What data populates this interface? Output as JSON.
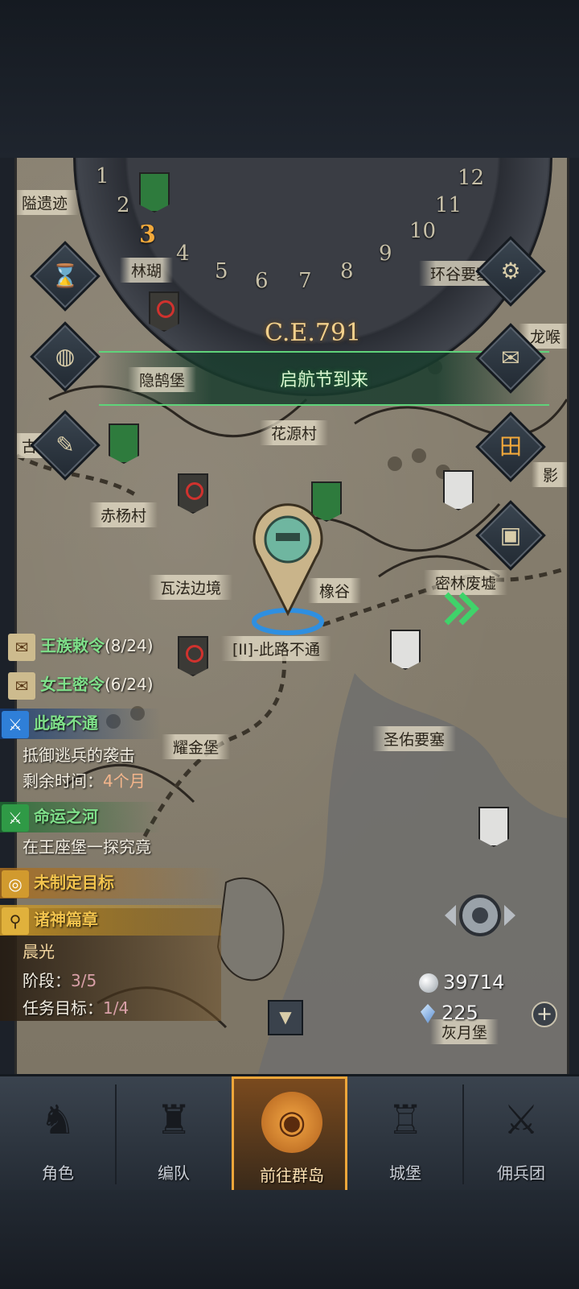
{
  "calendar": {
    "year": "C.E.791",
    "months": [
      "1",
      "2",
      "3",
      "4",
      "5",
      "6",
      "7",
      "8",
      "9",
      "10",
      "11",
      "12"
    ],
    "current_month": "3"
  },
  "event_banner": "启航节到来",
  "locations": {
    "yuyiyizhi": "隘遗迹",
    "linmu": "林瑚",
    "huangu": "环谷要塞",
    "longhou": "龙喉",
    "yinhuebao": "隐鹄堡",
    "huayuan": "花源村",
    "chiyang": "赤杨村",
    "wafa": "瓦法边境",
    "xianggu": "橡谷",
    "milin": "密林废墟",
    "cilubutong": "[II]-此路不通",
    "yaojin": "耀金堡",
    "shengyou": "圣佑要塞",
    "huoyue": "灰月堡",
    "gumu": "古木",
    "ying": "影"
  },
  "quests": {
    "royal_decree": {
      "label": "王族敕令",
      "progress": "(8/24)"
    },
    "queen_secret": {
      "label": "女王密令",
      "progress": "(6/24)"
    },
    "road_blocked": {
      "title": "此路不通",
      "desc": "抵御逃兵的袭击",
      "time_label": "剩余时间：",
      "time_value": "4个月"
    },
    "fate_river": {
      "title": "命运之河",
      "desc": "在王座堡一探究竟"
    },
    "no_goal": {
      "title": "未制定目标"
    },
    "gods_chapter": {
      "title": "诸神篇章",
      "name": "晨光",
      "stage_label": "阶段：",
      "stage_value": "3/5",
      "task_label": "任务目标：",
      "task_value": "1/4"
    }
  },
  "currency": {
    "silver": "39714",
    "crystal": "225"
  },
  "side_buttons_left": [
    "hourglass-icon",
    "money-bag-icon",
    "scroll-icon"
  ],
  "side_buttons_right": [
    "gear-icon",
    "mail-icon",
    "calendar-icon",
    "supply-icon"
  ],
  "nav": {
    "items": [
      "角色",
      "编队",
      "前往群岛",
      "城堡",
      "佣兵团"
    ],
    "active_index": 2
  },
  "colors": {
    "quest_green": "#7fe08a",
    "quest_gold": "#f3c44d",
    "nav_active_border": "#f0a63a"
  }
}
